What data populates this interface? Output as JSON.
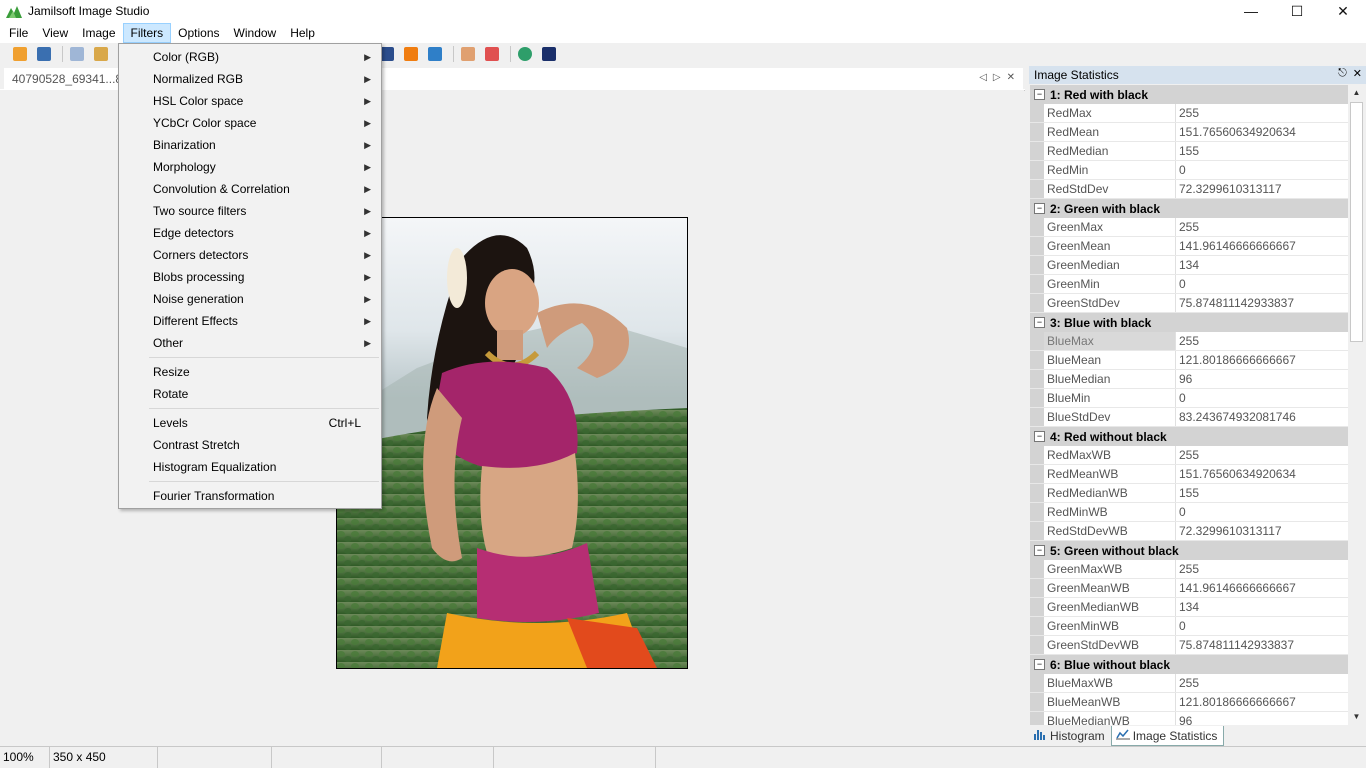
{
  "window": {
    "title": "Jamilsoft Image Studio",
    "controls": {
      "minimize": "—",
      "maximize": "☐",
      "close": "✕"
    }
  },
  "menubar": [
    "File",
    "View",
    "Image",
    "Filters",
    "Options",
    "Window",
    "Help"
  ],
  "toolbar": {
    "icons": [
      "open-icon",
      "save-icon",
      "copy-icon",
      "paste-icon",
      "envelope-icon",
      "fire-icon",
      "window-icon",
      "grid-icon",
      "grid-red-icon",
      "globe-icon",
      "star-icon"
    ]
  },
  "document": {
    "tab_label": "40790528_69341...8",
    "tab_controls": {
      "prev": "◁",
      "next": "▷",
      "close": "✕"
    },
    "image_alt": "Photo of a woman in a pink outfit on a green hillside"
  },
  "filters_menu": {
    "items": [
      {
        "label": "Color (RGB)",
        "submenu": true
      },
      {
        "label": "Normalized RGB",
        "submenu": true
      },
      {
        "label": "HSL Color space",
        "submenu": true
      },
      {
        "label": "YCbCr Color space",
        "submenu": true
      },
      {
        "label": "Binarization",
        "submenu": true
      },
      {
        "label": "Morphology",
        "submenu": true
      },
      {
        "label": "Convolution & Correlation",
        "submenu": true
      },
      {
        "label": "Two source filters",
        "submenu": true
      },
      {
        "label": "Edge detectors",
        "submenu": true
      },
      {
        "label": "Corners detectors",
        "submenu": true
      },
      {
        "label": "Blobs processing",
        "submenu": true
      },
      {
        "label": "Noise generation",
        "submenu": true
      },
      {
        "label": "Different Effects",
        "submenu": true
      },
      {
        "label": "Other",
        "submenu": true
      }
    ],
    "group2": [
      "Resize",
      "Rotate"
    ],
    "group3": [
      {
        "label": "Levels",
        "shortcut": "Ctrl+L"
      },
      {
        "label": "Contrast Stretch",
        "shortcut": ""
      },
      {
        "label": "Histogram Equalization",
        "shortcut": ""
      }
    ],
    "group4": [
      "Fourier Transformation"
    ]
  },
  "panel": {
    "title": "Image Statistics",
    "pin": "📌",
    "close": "✕",
    "categories": [
      {
        "name": "1: Red with black",
        "rows": [
          {
            "k": "RedMax",
            "v": "255"
          },
          {
            "k": "RedMean",
            "v": "151.76560634920634"
          },
          {
            "k": "RedMedian",
            "v": "155"
          },
          {
            "k": "RedMin",
            "v": "0"
          },
          {
            "k": "RedStdDev",
            "v": "72.3299610313117"
          }
        ]
      },
      {
        "name": "2: Green with black",
        "rows": [
          {
            "k": "GreenMax",
            "v": "255"
          },
          {
            "k": "GreenMean",
            "v": "141.96146666666667"
          },
          {
            "k": "GreenMedian",
            "v": "134"
          },
          {
            "k": "GreenMin",
            "v": "0"
          },
          {
            "k": "GreenStdDev",
            "v": "75.874811142933837"
          }
        ]
      },
      {
        "name": "3: Blue with black",
        "rows": [
          {
            "k": "BlueMax",
            "v": "255",
            "selected": true
          },
          {
            "k": "BlueMean",
            "v": "121.80186666666667"
          },
          {
            "k": "BlueMedian",
            "v": "96"
          },
          {
            "k": "BlueMin",
            "v": "0"
          },
          {
            "k": "BlueStdDev",
            "v": "83.243674932081746"
          }
        ]
      },
      {
        "name": "4: Red without black",
        "rows": [
          {
            "k": "RedMaxWB",
            "v": "255"
          },
          {
            "k": "RedMeanWB",
            "v": "151.76560634920634"
          },
          {
            "k": "RedMedianWB",
            "v": "155"
          },
          {
            "k": "RedMinWB",
            "v": "0"
          },
          {
            "k": "RedStdDevWB",
            "v": "72.3299610313117"
          }
        ]
      },
      {
        "name": "5: Green without black",
        "rows": [
          {
            "k": "GreenMaxWB",
            "v": "255"
          },
          {
            "k": "GreenMeanWB",
            "v": "141.96146666666667"
          },
          {
            "k": "GreenMedianWB",
            "v": "134"
          },
          {
            "k": "GreenMinWB",
            "v": "0"
          },
          {
            "k": "GreenStdDevWB",
            "v": "75.874811142933837"
          }
        ]
      },
      {
        "name": "6: Blue without black",
        "rows": [
          {
            "k": "BlueMaxWB",
            "v": "255"
          },
          {
            "k": "BlueMeanWB",
            "v": "121.80186666666667"
          },
          {
            "k": "BlueMedianWB",
            "v": "96"
          }
        ]
      }
    ],
    "tabs": [
      {
        "label": "Histogram",
        "icon": "histogram-icon",
        "active": false
      },
      {
        "label": "Image Statistics",
        "icon": "chart-icon",
        "active": true
      }
    ]
  },
  "statusbar": {
    "zoom": "100%",
    "size": "350 x 450"
  },
  "colors": {
    "menu_highlight": "#cce8ff",
    "panel_header": "#d6e2ee",
    "category_bg": "#d3d3d3"
  }
}
